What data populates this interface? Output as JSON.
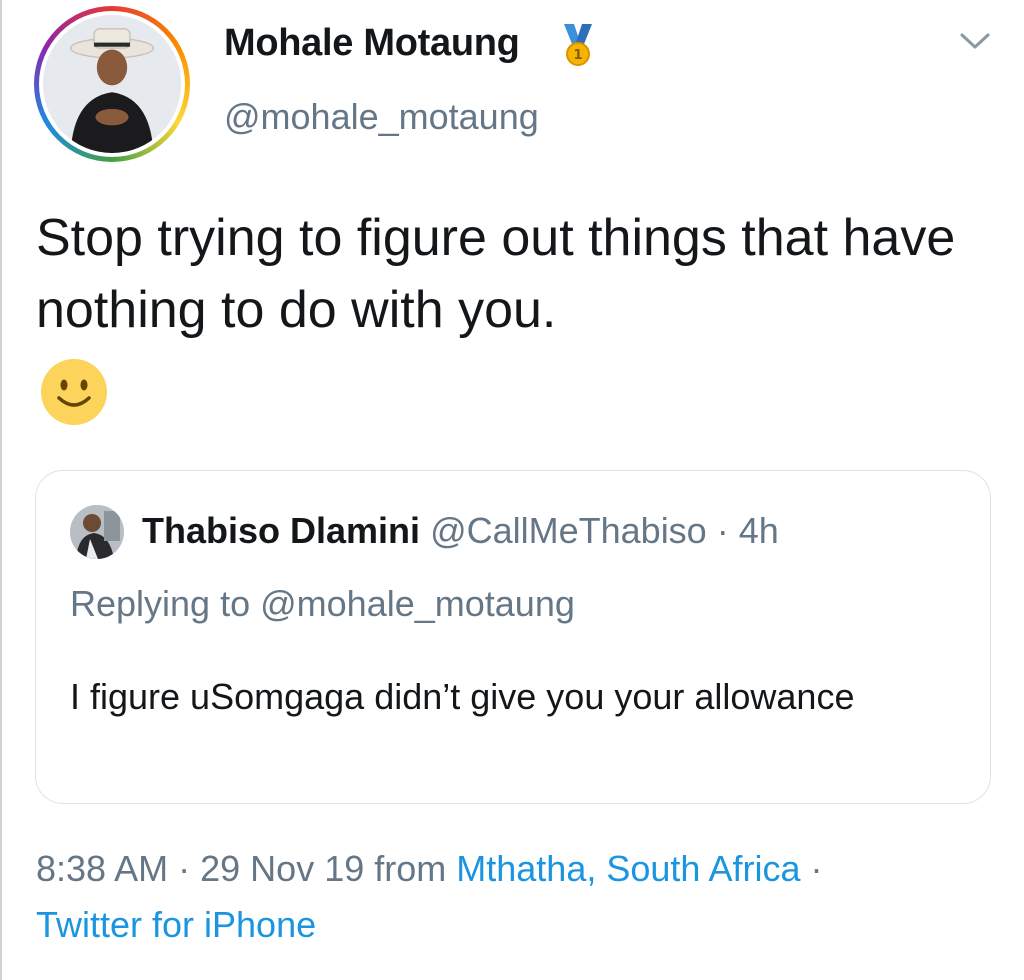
{
  "tweet": {
    "author_name": "Mohale Motaung",
    "author_handle": "@mohale_motaung",
    "text": "Stop trying to figure out things that have nothing to do with you.",
    "badge_icon": "gold-medal-icon",
    "menu_icon": "chevron-down-icon",
    "emoji": "slightly-smiling-face-emoji"
  },
  "quote": {
    "author_name": "Thabiso Dlamini",
    "author_handle": "@CallMeThabiso",
    "separator": "·",
    "time": "4h",
    "replying_prefix": "Replying to",
    "replying_handle": "@mohale_motaung",
    "text": "I figure uSomgaga didn’t give you your allowance"
  },
  "meta": {
    "time": "8:38 AM",
    "separator": "·",
    "date": "29 Nov 19",
    "from_label": "from",
    "location": "Mthatha, South Africa",
    "source": "Twitter for iPhone"
  },
  "colors": {
    "text_primary": "#14171a",
    "text_secondary": "#657786",
    "link": "#1b95e0",
    "border": "#dde2e6"
  }
}
